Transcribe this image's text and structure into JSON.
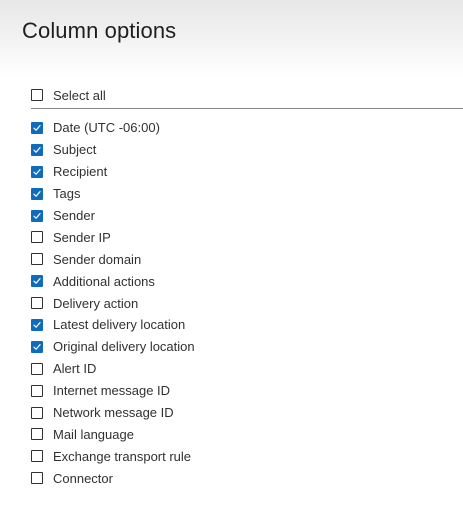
{
  "panel": {
    "title": "Column options",
    "select_all": {
      "label": "Select all",
      "checked": false
    }
  },
  "colors": {
    "accent": "#0f6cbd",
    "text": "#323130",
    "divider": "#8a8886"
  },
  "columns": [
    {
      "label": "Date (UTC -06:00)",
      "checked": true
    },
    {
      "label": "Subject",
      "checked": true
    },
    {
      "label": "Recipient",
      "checked": true
    },
    {
      "label": "Tags",
      "checked": true
    },
    {
      "label": "Sender",
      "checked": true
    },
    {
      "label": "Sender IP",
      "checked": false
    },
    {
      "label": "Sender domain",
      "checked": false
    },
    {
      "label": "Additional actions",
      "checked": true
    },
    {
      "label": "Delivery action",
      "checked": false
    },
    {
      "label": "Latest delivery location",
      "checked": true
    },
    {
      "label": "Original delivery location",
      "checked": true
    },
    {
      "label": "Alert ID",
      "checked": false
    },
    {
      "label": "Internet message ID",
      "checked": false
    },
    {
      "label": "Network message ID",
      "checked": false
    },
    {
      "label": "Mail language",
      "checked": false
    },
    {
      "label": "Exchange transport rule",
      "checked": false
    },
    {
      "label": "Connector",
      "checked": false
    }
  ]
}
